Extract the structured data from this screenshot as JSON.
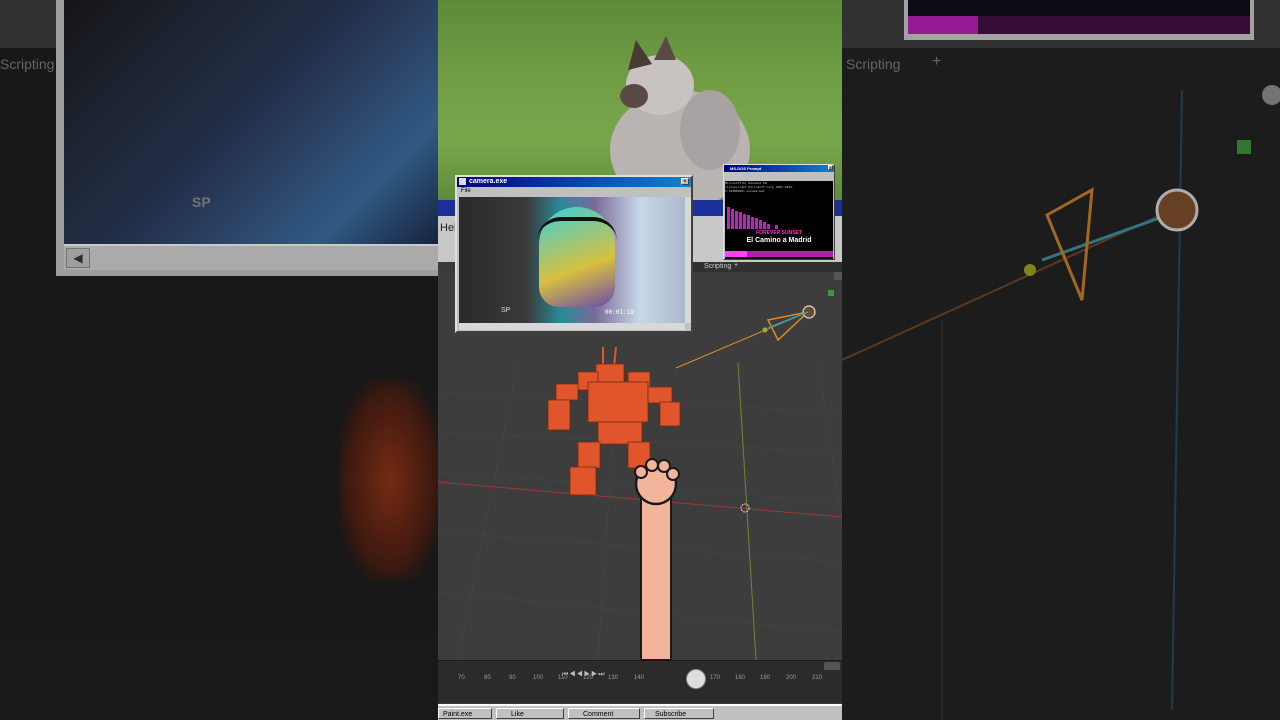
{
  "camera_window": {
    "title": "camera.exe",
    "menu": "File",
    "timestamp": "00:01:19",
    "watermark": "SP"
  },
  "msdos_window": {
    "title": "MS-DOS Prompt",
    "line1": "Microsoft(R) Windows 98",
    "line2": "(C)Copyright Microsoft Corp 1981-1999.",
    "prompt": "C:\\WINDOWS> winamp.bat",
    "song_label": "FOREVER SUNSET",
    "song_title": "El Camino a Madrid",
    "accent": "#ff00ff"
  },
  "blender": {
    "workspace_tab": "Scripting",
    "add_tab": "+",
    "help_menu": "Hel",
    "timeline_ticks": [
      "70",
      "80",
      "90",
      "100",
      "110",
      "120",
      "130",
      "140",
      "170",
      "180",
      "190",
      "200",
      "210"
    ]
  },
  "taskbar": {
    "items": [
      "Paint.exe",
      "Like",
      "Comment",
      "Subscribe"
    ]
  },
  "background": {
    "left_scripting": "Scripting",
    "right_scripting": "Scripting",
    "right_plus": "+",
    "left_watermark": "SP"
  },
  "colors": {
    "mech": "#e0552b",
    "camera_orange": "#e08a2a",
    "win_blue": "#000080",
    "arm": "#f2b49a"
  }
}
